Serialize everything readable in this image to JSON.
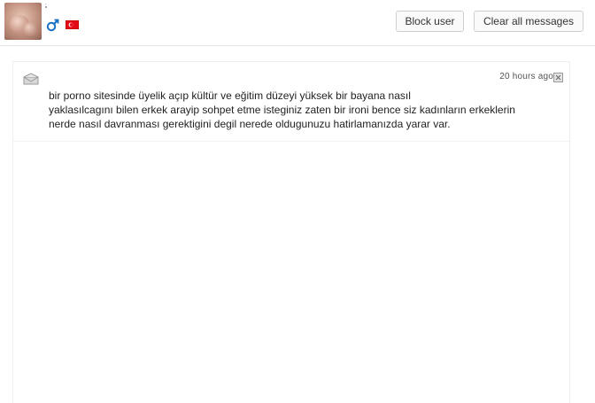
{
  "header": {
    "username": "'",
    "gender_icon": "male-symbol-icon",
    "flag_icon": "turkey-flag-icon",
    "block_label": "Block user",
    "clear_label": "Clear all messages"
  },
  "message": {
    "icon": "envelope-icon",
    "time": "20 hours ago",
    "line1": "bir porno sitesinde üyelik açıp kültür ve eğitim düzeyi yüksek bir bayana nasıl",
    "line2": "yaklasılcagını bilen erkek arayip sohpet etme isteginiz zaten bir ironi bence siz kadınların erkeklerin",
    "line3": "nerde nasıl davranması gerektigini degil nerede oldugunuzu hatirlamanızda yarar var."
  },
  "colors": {
    "gender": "#1a6fc2",
    "flag": "#e30a17",
    "border": "#e6e6e6"
  }
}
